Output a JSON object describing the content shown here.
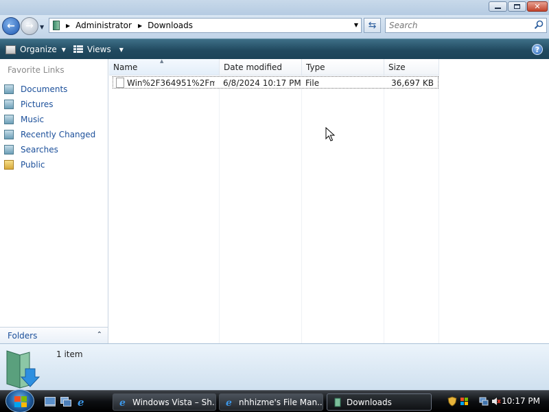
{
  "window": {
    "caption_buttons": [
      "minimize",
      "maximize",
      "close"
    ]
  },
  "address_bar": {
    "breadcrumbs": [
      "Administrator",
      "Downloads"
    ],
    "search_placeholder": "Search"
  },
  "command_bar": {
    "organize_label": "Organize",
    "views_label": "Views"
  },
  "nav_pane": {
    "favorite_links_title": "Favorite Links",
    "items": [
      {
        "label": "Documents",
        "icon": "documents-icon"
      },
      {
        "label": "Pictures",
        "icon": "pictures-icon"
      },
      {
        "label": "Music",
        "icon": "music-icon"
      },
      {
        "label": "Recently Changed",
        "icon": "recently-changed-icon"
      },
      {
        "label": "Searches",
        "icon": "searches-icon"
      },
      {
        "label": "Public",
        "icon": "folder-icon"
      }
    ],
    "folders_label": "Folders"
  },
  "file_list": {
    "columns": [
      "Name",
      "Date modified",
      "Type",
      "Size"
    ],
    "sorted_column": "Name",
    "rows": [
      {
        "name": "Win%2F364951%2Fmi...",
        "date_modified": "6/8/2024 10:17 PM",
        "type": "File",
        "size": "36,697 KB"
      }
    ]
  },
  "details_pane": {
    "item_count": "1 item"
  },
  "taskbar": {
    "buttons": [
      {
        "label": "Windows Vista – Sh...",
        "icon": "ie-icon",
        "active": false
      },
      {
        "label": "nhhizme's File Man...",
        "icon": "ie-icon",
        "active": false
      },
      {
        "label": "Downloads",
        "icon": "explorer-folder-icon",
        "active": true
      }
    ],
    "clock": "10:17 PM"
  },
  "colors": {
    "link": "#1b4f9a",
    "command_bar": "#214a60",
    "taskbar": "#0d0f12"
  }
}
